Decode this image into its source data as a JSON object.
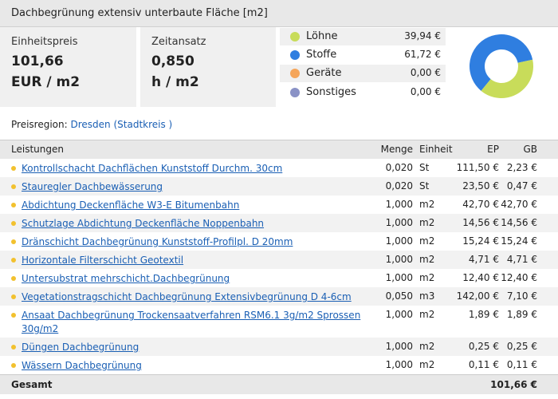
{
  "title": "Dachbegrünung extensiv unterbaute Fläche [m2]",
  "summary": {
    "unit_price_label": "Einheitspreis",
    "unit_price_value": "101,66",
    "unit_price_unit": "EUR / m2",
    "time_label": "Zeitansatz",
    "time_value": "0,850",
    "time_unit": "h / m2"
  },
  "cost_breakdown": [
    {
      "name": "Löhne",
      "amount": "39,94 €",
      "value": 39.94,
      "color": "#c8dc5a"
    },
    {
      "name": "Stoffe",
      "amount": "61,72 €",
      "value": 61.72,
      "color": "#2f7ee0"
    },
    {
      "name": "Geräte",
      "amount": "0,00 €",
      "value": 0,
      "color": "#f5a55a"
    },
    {
      "name": "Sonstiges",
      "amount": "0,00 €",
      "value": 0,
      "color": "#8a92c6"
    }
  ],
  "region": {
    "label": "Preisregion:",
    "value": "Dresden (Stadtkreis )"
  },
  "table": {
    "headers": {
      "leistungen": "Leistungen",
      "menge": "Menge",
      "einheit": "Einheit",
      "ep": "EP",
      "gb": "GB"
    },
    "rows": [
      {
        "desc": "Kontrollschacht Dachflächen Kunststoff Durchm. 30cm",
        "menge": "0,020",
        "einheit": "St",
        "ep": "111,50 €",
        "gb": "2,23 €"
      },
      {
        "desc": "Stauregler Dachbewässerung",
        "menge": "0,020",
        "einheit": "St",
        "ep": "23,50 €",
        "gb": "0,47 €"
      },
      {
        "desc": "Abdichtung Deckenfläche W3-E Bitumenbahn",
        "menge": "1,000",
        "einheit": "m2",
        "ep": "42,70 €",
        "gb": "42,70 €"
      },
      {
        "desc": "Schutzlage Abdichtung Deckenfläche Noppenbahn",
        "menge": "1,000",
        "einheit": "m2",
        "ep": "14,56 €",
        "gb": "14,56 €"
      },
      {
        "desc": "Dränschicht Dachbegrünung Kunststoff-Profilpl. D 20mm",
        "menge": "1,000",
        "einheit": "m2",
        "ep": "15,24 €",
        "gb": "15,24 €"
      },
      {
        "desc": "Horizontale Filterschicht Geotextil",
        "menge": "1,000",
        "einheit": "m2",
        "ep": "4,71 €",
        "gb": "4,71 €"
      },
      {
        "desc": "Untersubstrat mehrschicht.Dachbegrünung",
        "menge": "1,000",
        "einheit": "m2",
        "ep": "12,40 €",
        "gb": "12,40 €"
      },
      {
        "desc": "Vegetationstragschicht Dachbegrünung Extensivbegrünung D 4-6cm",
        "menge": "0,050",
        "einheit": "m3",
        "ep": "142,00 €",
        "gb": "7,10 €"
      },
      {
        "desc": "Ansaat Dachbegrünung Trockensaatverfahren RSM6.1 3g/m2 Sprossen 30g/m2",
        "menge": "1,000",
        "einheit": "m2",
        "ep": "1,89 €",
        "gb": "1,89 €"
      },
      {
        "desc": "Düngen Dachbegrünung",
        "menge": "1,000",
        "einheit": "m2",
        "ep": "0,25 €",
        "gb": "0,25 €"
      },
      {
        "desc": "Wässern Dachbegrünung",
        "menge": "1,000",
        "einheit": "m2",
        "ep": "0,11 €",
        "gb": "0,11 €"
      }
    ],
    "total_label": "Gesamt",
    "total_value": "101,66 €"
  }
}
